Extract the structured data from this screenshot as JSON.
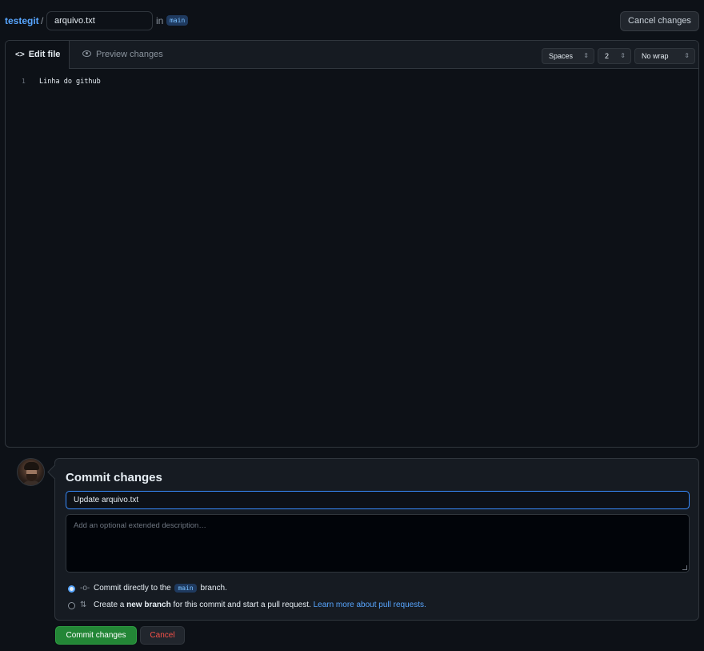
{
  "header": {
    "repo": "testegit",
    "separator": "/",
    "filename": "arquivo.txt",
    "in_label": "in",
    "branch": "main",
    "cancel_label": "Cancel changes"
  },
  "editor": {
    "tabs": {
      "edit": "Edit file",
      "preview": "Preview changes"
    },
    "indent_mode": "Spaces",
    "indent_size": "2",
    "wrap_mode": "No wrap",
    "lines": [
      {
        "number": "1",
        "text": "Linha do github"
      }
    ]
  },
  "commit": {
    "title": "Commit changes",
    "summary_value": "Update arquivo.txt",
    "description_placeholder": "Add an optional extended description…",
    "option_direct": {
      "prefix": "Commit directly to the",
      "branch": "main",
      "suffix": "branch.",
      "selected": true
    },
    "option_new_branch": {
      "prefix": "Create a",
      "bold": "new branch",
      "middle": "for this commit and start a pull request.",
      "link": "Learn more about pull requests.",
      "selected": false
    },
    "commit_button": "Commit changes",
    "cancel_button": "Cancel"
  },
  "colors": {
    "accent": "#58a6ff",
    "primary_button": "#238636",
    "danger": "#f85149",
    "background": "#0d1117"
  }
}
